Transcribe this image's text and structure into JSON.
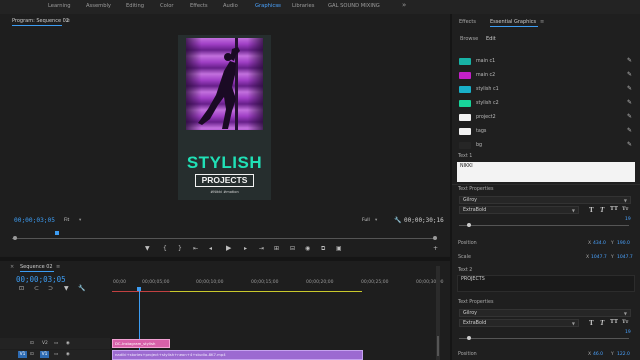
{
  "workspaces": [
    "Learning",
    "Assembly",
    "Editing",
    "Color",
    "Effects",
    "Audio",
    "Graphics",
    "Libraries",
    "GAL SOUND MIXING"
  ],
  "active_workspace_menu": "≡",
  "program": {
    "title": "Program: Sequence 02",
    "menu": "≡",
    "timecode": "00;00;03;05",
    "fit_label": "Fit",
    "quality_label": "Full",
    "duration": "00;00;30;16"
  },
  "graphic": {
    "title": "STYLISH",
    "subtitle": "PROJECTS",
    "hashtags": "#Nikki #motion",
    "accent": "#20e0b6",
    "glow": "#d44bff"
  },
  "eg": {
    "tab1": "Effects",
    "tab2": "Essential Graphics",
    "browse": "Browse",
    "edit": "Edit",
    "swatches": [
      {
        "label": "main c1",
        "color": "#18b3a6"
      },
      {
        "label": "main c2",
        "color": "#c420c9"
      },
      {
        "label": "stylish c1",
        "color": "#19b0c9"
      },
      {
        "label": "stylish c2",
        "color": "#18d49a"
      },
      {
        "label": "project2",
        "color": "#f2f2f2"
      },
      {
        "label": "tags",
        "color": "#f2f2f2"
      },
      {
        "label": "bg",
        "color": "#262626"
      }
    ],
    "text1_label": "Text 1",
    "text1_value": "NIKKI",
    "text_props": "Text Properties",
    "font": "Gilroy",
    "weight": "ExtraBold",
    "size_value": "19",
    "position_label": "Position",
    "position_x": "434.0",
    "position_y": "190.0",
    "scale_label": "Scale",
    "scale_x": "1047.7",
    "scale_y": "1047.7",
    "text2_label": "Text 2",
    "text2_value": "PROJECTS",
    "text_props2": "Text Properties",
    "font2": "Gilroy",
    "weight2": "ExtraBold",
    "size_value2": "19",
    "position2_label": "Position",
    "position2_x": "46.0",
    "position2_y": "122.0",
    "x_label": "X",
    "y_label": "Y"
  },
  "sequence": {
    "title": "Sequence 02",
    "timecode": "00;00;03;05",
    "ruler": [
      "00;00",
      "00;00;05;00",
      "00;00;10;00",
      "00;00;15;00",
      "00;00;20;00",
      "00;00;25;00",
      "00;00;30;00",
      "00;00;35;00"
    ],
    "tracks": [
      "V2",
      "V1"
    ],
    "clip_v2": "DC-Instagram_stylish",
    "clip_v1": "nadiki+stories+project+stylish+neon+4+studio-8K7.mp4"
  }
}
